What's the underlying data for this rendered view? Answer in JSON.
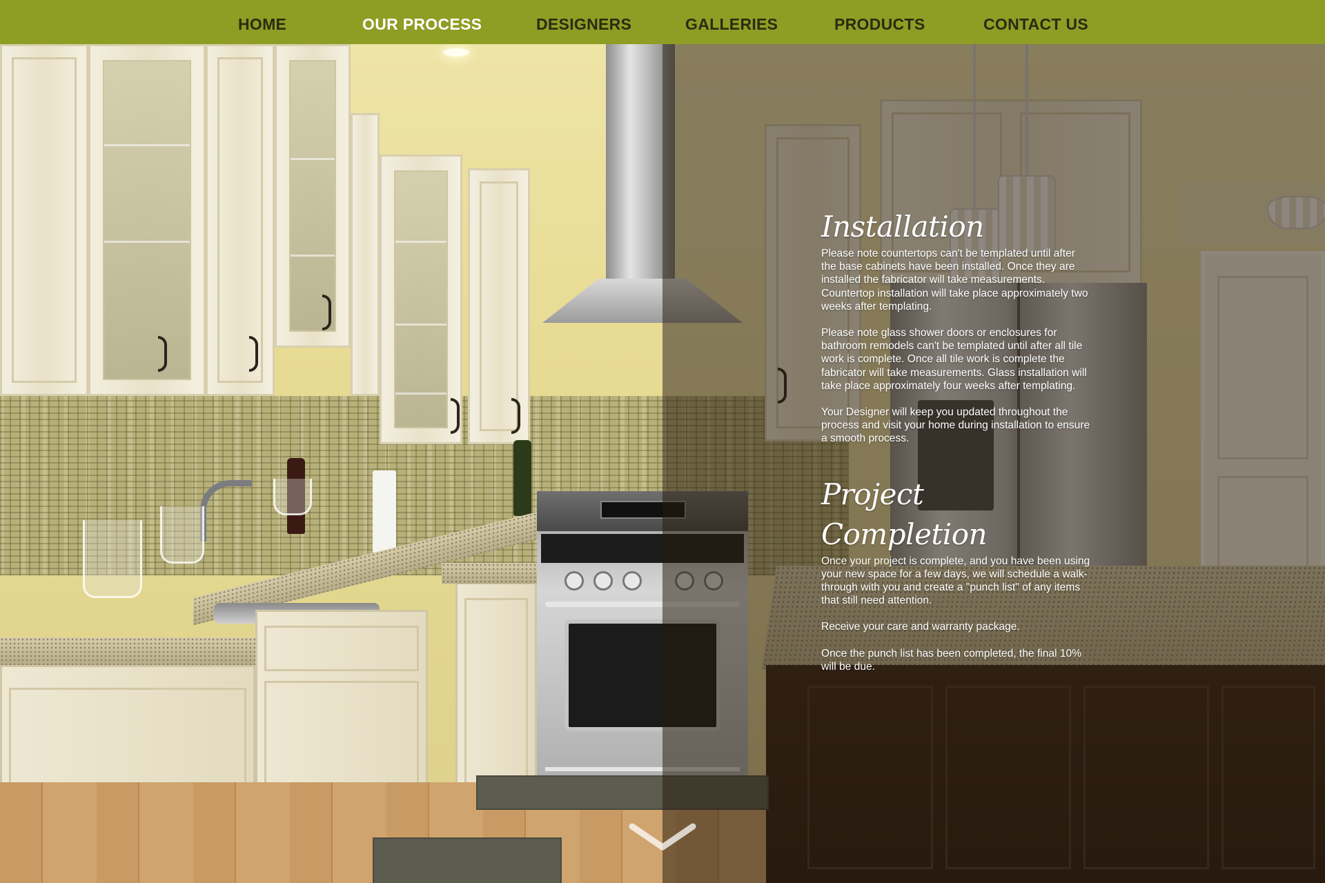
{
  "nav": {
    "items": [
      {
        "label": "HOME",
        "active": false
      },
      {
        "label": "OUR PROCESS",
        "active": true
      },
      {
        "label": "DESIGNERS",
        "active": false
      },
      {
        "label": "GALLERIES",
        "active": false
      },
      {
        "label": "PRODUCTS",
        "active": false
      },
      {
        "label": "CONTACT US",
        "active": false
      }
    ],
    "bar_color": "#8e9d24",
    "active_color": "#ffffff",
    "text_color": "#2b2b12"
  },
  "installation": {
    "title": "Installation",
    "paragraphs": [
      "Please note countertops can't be templated until after the base cabinets have been installed. Once they are installed the fabricator will take measurements. Countertop installation will take place approximately two weeks after templating.",
      "Please note glass shower doors or enclosures for bathroom remodels can't be templated until after all tile work is complete. Once all tile work is complete the fabricator will take measurements. Glass installation will take place approximately four weeks after templating.",
      "Your Designer will keep you updated throughout the process and visit your home during installation to ensure a smooth process."
    ]
  },
  "completion": {
    "title": "Project Completion",
    "paragraphs": [
      "Once your project is complete, and you have been using your new space for a few days, we will schedule a walk-through with you and create a \"punch list\" of any items that still need attention.",
      "Receive your care and warranty package.",
      "Once the punch list has been completed, the final 10% will be due."
    ]
  },
  "scroll": {
    "icon": "chevron-down-icon"
  },
  "background": {
    "icon": "kitchen-photo",
    "overlay_color": "#261a0e"
  }
}
